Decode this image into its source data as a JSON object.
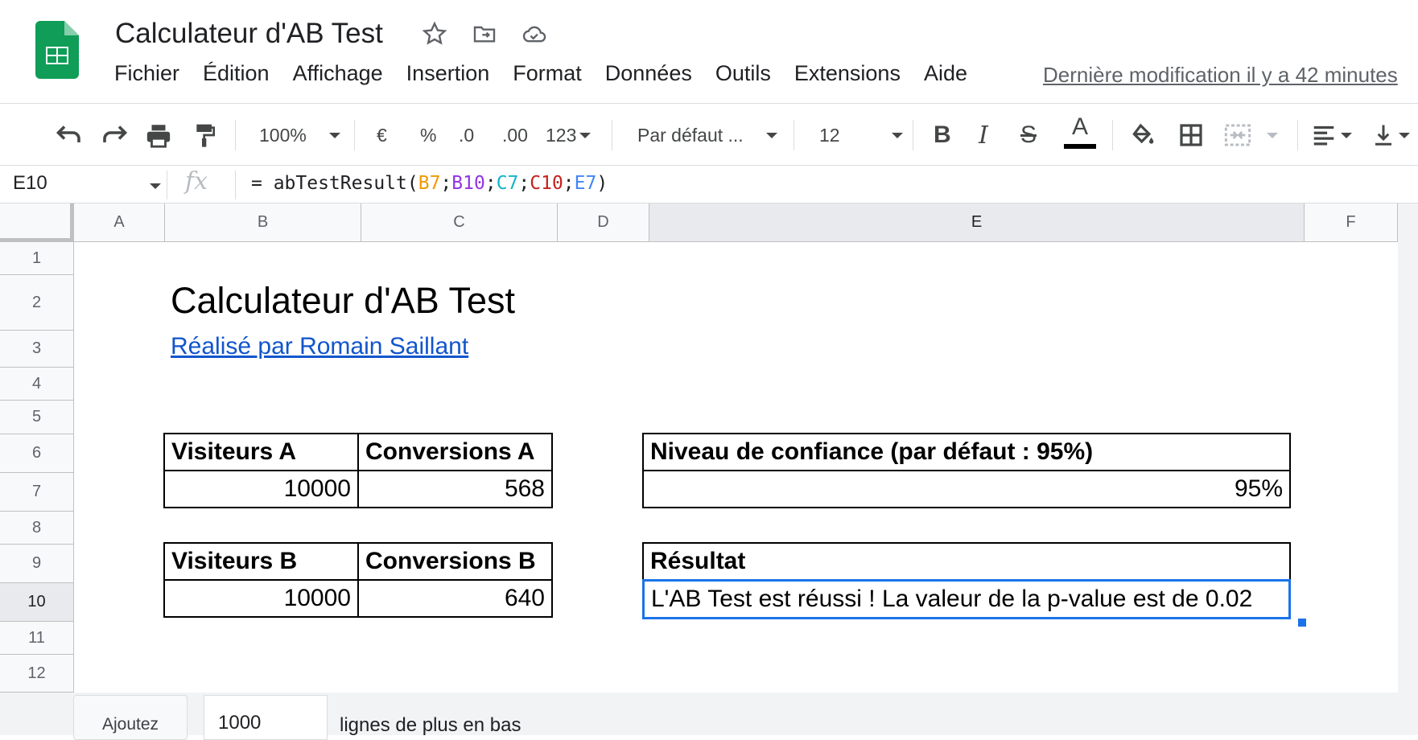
{
  "app": {
    "doc_title": "Calculateur d'AB Test",
    "brand_color": "#0f9d58",
    "title_icons": [
      "star-icon",
      "move-to-folder-icon",
      "cloud-status-icon"
    ]
  },
  "menu": {
    "items": [
      "Fichier",
      "Édition",
      "Affichage",
      "Insertion",
      "Format",
      "Données",
      "Outils",
      "Extensions",
      "Aide"
    ],
    "last_modified": "Dernière modification il y a 42 minutes"
  },
  "toolbar": {
    "zoom": "100%",
    "currency": "€",
    "percent": "%",
    "decrease_decimals": ".0",
    "increase_decimals": ".00",
    "more_formats": "123",
    "font": "Par défaut ...",
    "font_size": "12",
    "bold": "B",
    "italic": "I",
    "strike": "S",
    "text_color": "A"
  },
  "formula_bar": {
    "name_box": "E10",
    "fx": "fx",
    "formula_prefix": "= abTestResult(",
    "args": [
      {
        "text": "B7",
        "color": "#f29900"
      },
      {
        "text": "B10",
        "color": "#9334e6"
      },
      {
        "text": "C7",
        "color": "#12b5cb"
      },
      {
        "text": "C10",
        "color": "#c5221f"
      },
      {
        "text": "E7",
        "color": "#4285f4"
      }
    ],
    "separator": ";",
    "formula_suffix": ")"
  },
  "grid": {
    "columns": [
      "A",
      "B",
      "C",
      "D",
      "E",
      "F"
    ],
    "rows": [
      "1",
      "2",
      "3",
      "4",
      "5",
      "6",
      "7",
      "8",
      "9",
      "10",
      "11",
      "12"
    ],
    "selected_cell": "E10"
  },
  "sheet": {
    "title": "Calculateur d'AB Test",
    "author_link": "Réalisé par Romain Saillant",
    "table_a": {
      "visitors_label": "Visiteurs A",
      "conversions_label": "Conversions A",
      "visitors": "10000",
      "conversions": "568"
    },
    "table_b": {
      "visitors_label": "Visiteurs B",
      "conversions_label": "Conversions B",
      "visitors": "10000",
      "conversions": "640"
    },
    "confidence": {
      "label": "Niveau de confiance (par défaut : 95%)",
      "value": "95%"
    },
    "result": {
      "label": "Résultat",
      "value": "L'AB Test est réussi ! La valeur de la p-value est de 0.02"
    }
  },
  "bottom": {
    "add_button": "Ajoutez",
    "rows_value": "1000",
    "rows_text": "lignes de plus en bas"
  }
}
